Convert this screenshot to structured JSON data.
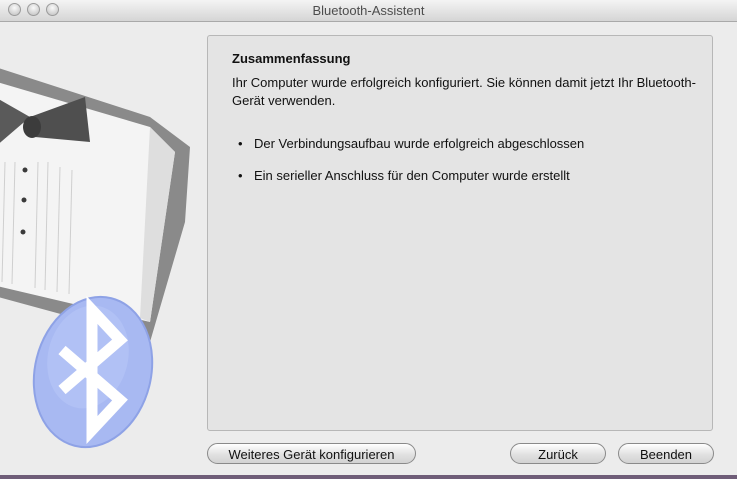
{
  "window": {
    "title": "Bluetooth-Assistent"
  },
  "summary": {
    "heading": "Zusammenfassung",
    "description": "Ihr Computer wurde erfolgreich konfiguriert. Sie können damit jetzt Ihr Bluetooth-Gerät verwenden.",
    "bullets": [
      "Der Verbindungsaufbau wurde erfolgreich abgeschlossen",
      "Ein serieller Anschluss für den Computer wurde erstellt"
    ]
  },
  "buttons": {
    "configure_another": "Weiteres Gerät konfigurieren",
    "back": "Zurück",
    "finish": "Beenden"
  },
  "bullet_glyph": "•",
  "icons": [
    "close-icon",
    "minimize-icon",
    "zoom-icon",
    "bluetooth-icon",
    "tuxedo-illustration"
  ],
  "colors": {
    "bluetooth_blue": "#9bb0f0",
    "panel_bg": "#e4e4e4",
    "window_bg": "#ececec"
  }
}
